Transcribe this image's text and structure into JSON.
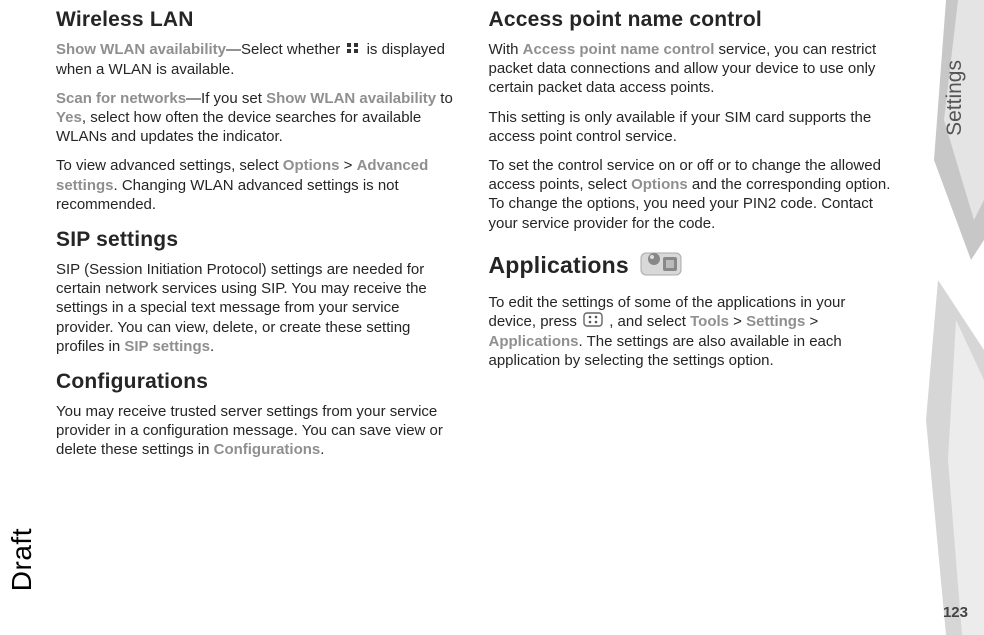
{
  "sideTab": "Settings",
  "pageNumber": "123",
  "watermark": "Draft",
  "left": {
    "h_wlan": "Wireless LAN",
    "wlan_p1_a": "Show WLAN availability",
    "wlan_p1_b": "—Select whether ",
    "wlan_p1_c": " is displayed when a WLAN is available.",
    "wlan_p2_a": "Scan for networks",
    "wlan_p2_b": "—If you set ",
    "wlan_p2_c": "Show WLAN availability",
    "wlan_p2_d": " to ",
    "wlan_p2_e": "Yes",
    "wlan_p2_f": ", select how often the device searches for available WLANs and updates the indicator.",
    "wlan_p3_a": "To view advanced settings, select ",
    "wlan_p3_b": "Options",
    "wlan_p3_c": " > ",
    "wlan_p3_d": "Advanced settings",
    "wlan_p3_e": ". Changing WLAN advanced settings is not recommended.",
    "h_sip": "SIP settings",
    "sip_p1_a": "SIP (Session Initiation Protocol) settings are needed for certain network services using SIP. You may receive the settings in a special text message from your service provider. You can view, delete, or create these setting profiles in ",
    "sip_p1_b": "SIP settings",
    "sip_p1_c": ".",
    "h_conf": "Configurations",
    "conf_p1_a": "You may receive trusted server settings from your service provider in a configuration message. You can save view or delete these settings in ",
    "conf_p1_b": "Configurations",
    "conf_p1_c": "."
  },
  "right": {
    "h_apn": "Access point name control",
    "apn_p1_a": "With ",
    "apn_p1_b": "Access point name control",
    "apn_p1_c": " service, you can restrict packet data connections and allow your device to use only certain packet data access points.",
    "apn_p2": "This setting is only available if your SIM card supports the access point control service.",
    "apn_p3_a": "To set the control service on or off or to change the allowed access points, select ",
    "apn_p3_b": "Options",
    "apn_p3_c": " and the corresponding option. To change the options, you need your PIN2 code. Contact your service provider for the code.",
    "h_apps": "Applications",
    "apps_p1_a": "To edit the settings of some of the applications in your device, press ",
    "apps_p1_b": " , and select ",
    "apps_p1_c": "Tools",
    "apps_p1_d": " > ",
    "apps_p1_e": "Settings",
    "apps_p1_f": " > ",
    "apps_p1_g": "Applications",
    "apps_p1_h": ". The settings are also available in each application by selecting the settings option."
  }
}
